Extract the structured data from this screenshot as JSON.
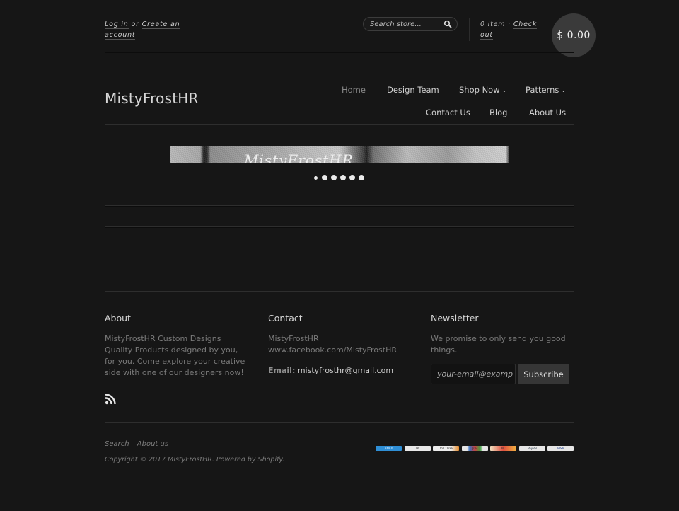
{
  "topbar": {
    "login_label": "Log in",
    "or_label": "or",
    "create_account_label": "Create an account",
    "search_placeholder": "Search store...",
    "cart_count_label": "0 item",
    "separator": "·",
    "checkout_label": "Check out",
    "cart_total": "$ 0.00"
  },
  "header": {
    "store_name": "MistyFrostHR",
    "nav": [
      {
        "label": "Home",
        "active": true
      },
      {
        "label": "Design Team"
      },
      {
        "label": "Shop Now",
        "dropdown": true
      },
      {
        "label": "Patterns",
        "dropdown": true
      },
      {
        "label": "Contact Us"
      },
      {
        "label": "Blog"
      },
      {
        "label": "About Us"
      }
    ],
    "chevron": "⌄"
  },
  "slideshow": {
    "image_text": "MistyFrostHR",
    "slide_count": 6,
    "active_slide": 1
  },
  "footer": {
    "about": {
      "heading": "About",
      "text": "MistyFrostHR Custom Designs Quality Products designed by you, for you. Come explore your creative side with one of our designers now!"
    },
    "contact": {
      "heading": "Contact",
      "line1": "MistyFrostHR",
      "line2": "www.facebook.com/MistyFrostHR",
      "email_label": "Email:",
      "email": "mistyfrosthr@gmail.com"
    },
    "newsletter": {
      "heading": "Newsletter",
      "text": "We promise to only send you good things.",
      "email_placeholder": "your-email@example.com",
      "subscribe_label": "Subscribe"
    },
    "links": [
      "Search",
      "About us"
    ],
    "copyright": "Copyright © 2017 MistyFrostHR. Powered by Shopify.",
    "payment_icons": [
      {
        "name": "american-express",
        "label": "AMEX",
        "color": "#2f8fd6"
      },
      {
        "name": "diners-club",
        "label": "DC",
        "color": "#e8e8e8"
      },
      {
        "name": "discover",
        "label": "DISCOVER",
        "color": "#ececec"
      },
      {
        "name": "jcb",
        "label": "JCB",
        "color": "#e6e6e6"
      },
      {
        "name": "master",
        "label": "MC",
        "color": "#e8c8a0"
      },
      {
        "name": "paypal",
        "label": "PayPal",
        "color": "#e6e6e6"
      },
      {
        "name": "visa",
        "label": "VISA",
        "color": "#e6e6e6"
      }
    ]
  }
}
